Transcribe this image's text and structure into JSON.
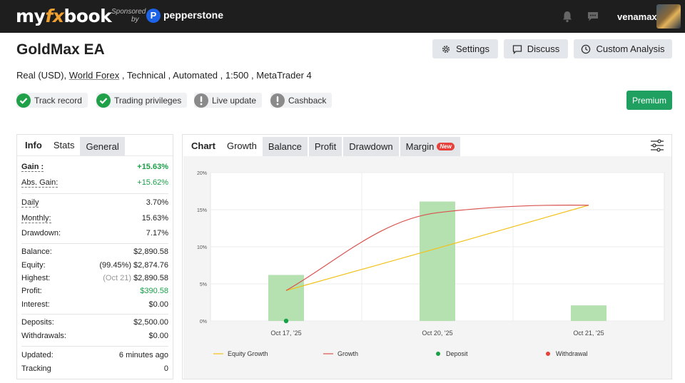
{
  "topbar": {
    "logo_my": "my",
    "logo_fx": "fx",
    "logo_book": "book",
    "sponsored": "Sponsored",
    "sponsored_by": "by",
    "sponsor_badge": "P",
    "sponsor_name": "pepperstone",
    "username": "venamax"
  },
  "header": {
    "title": "GoldMax EA",
    "settings_label": "Settings",
    "discuss_label": "Discuss",
    "custom_analysis_label": "Custom Analysis",
    "sub_a": "Real (USD), ",
    "sub_broker": "World Forex",
    "sub_b": " , Technical , Automated , 1:500 , MetaTrader 4"
  },
  "badges": {
    "track_record": "Track record",
    "trading_privileges": "Trading privileges",
    "live_update": "Live update",
    "cashback": "Cashback",
    "premium": "Premium"
  },
  "left_tabs": {
    "info": "Info",
    "stats": "Stats",
    "general": "General"
  },
  "stats": {
    "gain_label": "Gain :",
    "gain_value": "+15.63%",
    "abs_gain_label": "Abs. Gain:",
    "abs_gain_value": "+15.62%",
    "daily_label": "Daily",
    "daily_value": "3.70%",
    "monthly_label": "Monthly:",
    "monthly_value": "15.63%",
    "drawdown_label": "Drawdown:",
    "drawdown_value": "7.17%",
    "balance_label": "Balance:",
    "balance_value": "$2,890.58",
    "equity_label": "Equity:",
    "equity_value": "(99.45%) $2,874.76",
    "highest_label": "Highest:",
    "highest_date": "(Oct 21)",
    "highest_value": "$2,890.58",
    "profit_label": "Profit:",
    "profit_value": "$390.58",
    "interest_label": "Interest:",
    "interest_value": "$0.00",
    "deposits_label": "Deposits:",
    "deposits_value": "$2,500.00",
    "withdrawals_label": "Withdrawals:",
    "withdrawals_value": "$0.00",
    "updated_label": "Updated:",
    "updated_value": "6 minutes ago",
    "tracking_label": "Tracking",
    "tracking_value": "0"
  },
  "chart_tabs": {
    "chart": "Chart",
    "growth": "Growth",
    "balance": "Balance",
    "profit": "Profit",
    "drawdown": "Drawdown",
    "margin": "Margin",
    "new_tag": "New"
  },
  "colors": {
    "bar": "#b5e0b0",
    "equity_line": "#f2c21c",
    "growth_line": "#d9534f",
    "deposit": "#1aa048",
    "withdrawal": "#e8403a",
    "premium": "#20a060"
  },
  "chart_data": {
    "type": "bar",
    "categories": [
      "Oct 17, '25",
      "Oct 20, '25",
      "Oct 21, '25"
    ],
    "ylim": [
      0,
      20
    ],
    "yticks": [
      "0%",
      "5%",
      "10%",
      "15%",
      "20%"
    ],
    "grid": true,
    "legend_position": "bottom",
    "series": [
      {
        "name": "Growth",
        "kind": "bar",
        "values": [
          6.2,
          16.1,
          2.1
        ]
      },
      {
        "name": "Equity Growth",
        "kind": "line",
        "values": [
          4.1,
          9.8,
          15.6
        ]
      },
      {
        "name": "Growth",
        "kind": "line",
        "values": [
          4.1,
          14.6,
          15.6
        ]
      }
    ],
    "deposits": [
      0
    ],
    "legend": [
      "Equity Growth",
      "Growth",
      "Deposit",
      "Withdrawal"
    ]
  }
}
